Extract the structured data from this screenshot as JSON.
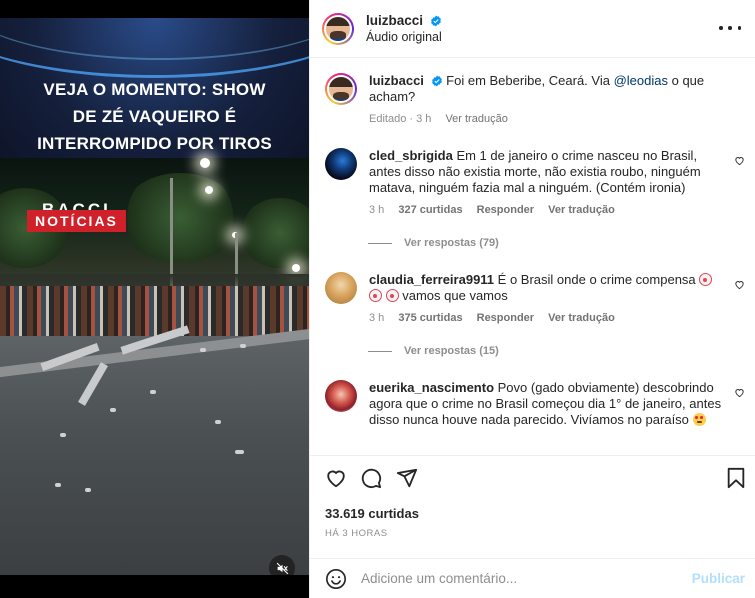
{
  "media": {
    "headline": "VEJA O MOMENTO: SHOW DE ZÉ VAQUEIRO É INTERROMPIDO POR TIROS",
    "headline_lines": [
      "VEJA O MOMENTO: SHOW",
      "DE ZÉ VAQUEIRO É",
      "INTERROMPIDO POR TIROS"
    ],
    "brand": "BACCI",
    "badge": "NOTÍCIAS",
    "badge_color": "#d0202a",
    "mute_icon": "speaker-muted-icon"
  },
  "header": {
    "username": "luizbacci",
    "subtitle": "Áudio original",
    "verified_color": "#0095f6",
    "more_icon": "more-horizontal-icon"
  },
  "caption": {
    "username": "luizbacci",
    "text_before": "Foi em Beberibe, Ceará. Via ",
    "mention": "@leodias",
    "text_after": " o que acham?",
    "meta_edited": "Editado · 3 h",
    "meta_translate": "Ver tradução"
  },
  "comments": [
    {
      "username": "cled_sbrigida",
      "text": "Em 1 de janeiro o crime nasceu no Brasil, antes disso não existia morte, não existia roubo, ninguém matava, ninguém fazia mal a ninguém. (Contém ironia)",
      "time": "3 h",
      "likes": "327 curtidas",
      "reply": "Responder",
      "translate": "Ver tradução",
      "view_replies": "Ver respostas (79)"
    },
    {
      "username": "claudia_ferreira9911",
      "text": "É o Brasil onde o crime compensa",
      "text_after": " vamos que vamos",
      "emoji": "clown-face-icon",
      "time": "3 h",
      "likes": "375 curtidas",
      "reply": "Responder",
      "translate": "Ver tradução",
      "view_replies": "Ver respostas (15)"
    },
    {
      "username": "euerika_nascimento",
      "text": "Povo (gado obviamente) descobrindo agora que o crime no Brasil começou dia 1° de janeiro, antes disso nunca houve nada parecido. Vivíamos no paraíso",
      "emoji": "heart-eyes-icon"
    }
  ],
  "actions": {
    "likes": "33.619 curtidas",
    "time_ago": "HÁ 3 HORAS"
  },
  "composer": {
    "placeholder": "Adicione um comentário...",
    "publish": "Publicar"
  }
}
